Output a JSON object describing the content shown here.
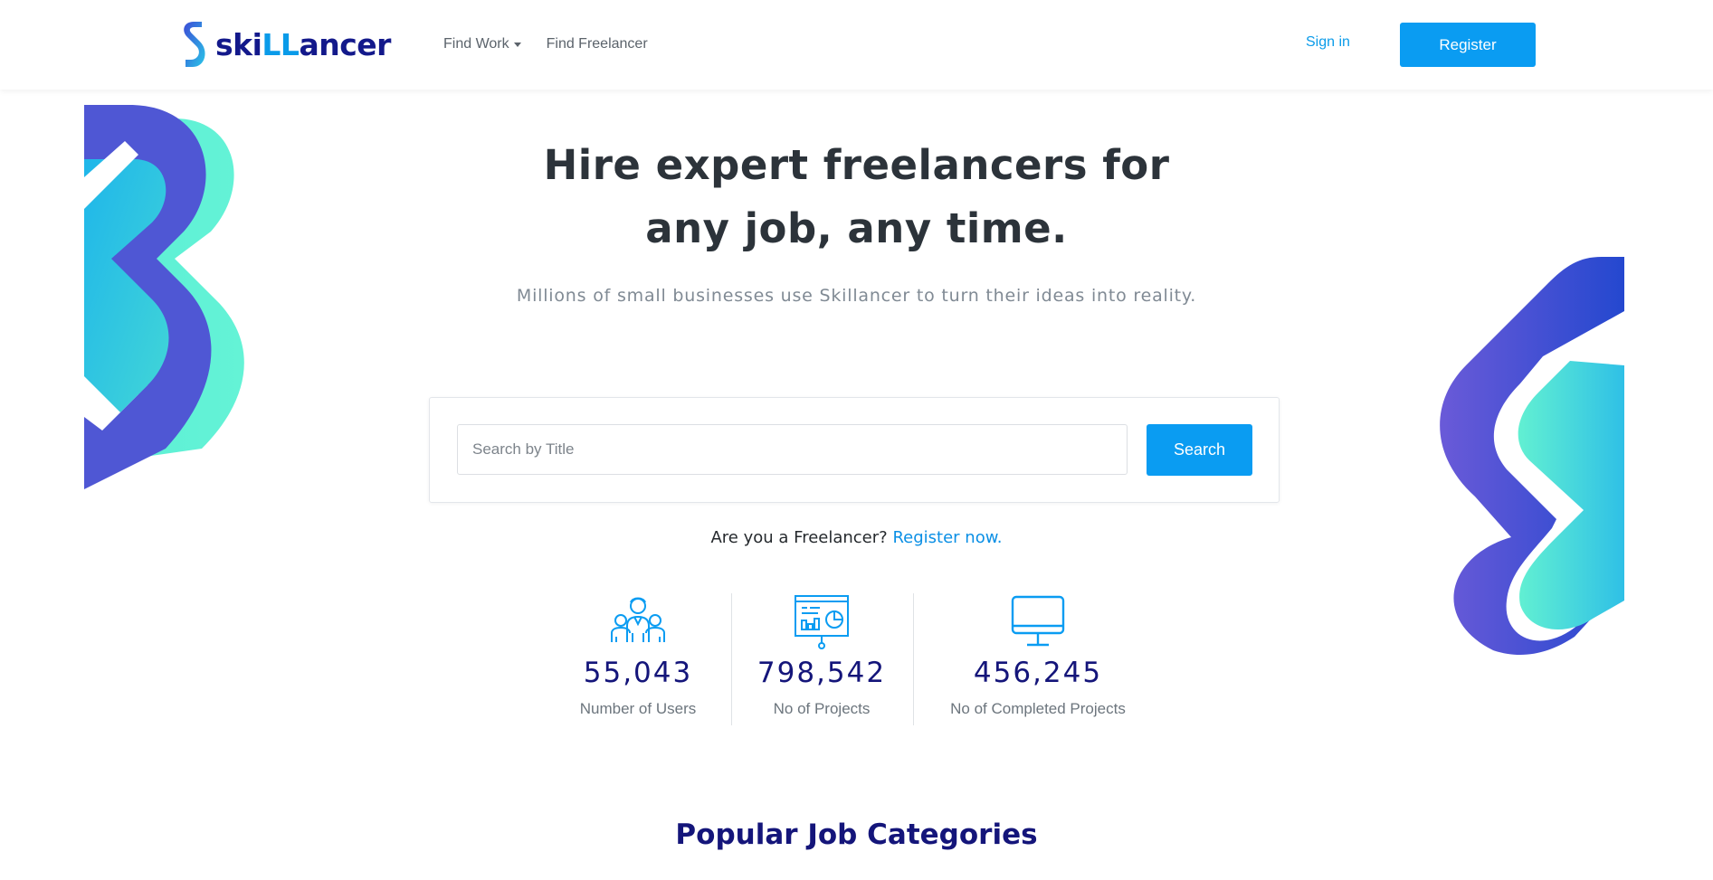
{
  "header": {
    "logo_text_pre": "ski",
    "logo_text_ll": "LL",
    "logo_text_post": "ancer",
    "nav": [
      {
        "label": "Find Work",
        "has_dropdown": true
      },
      {
        "label": "Find Freelancer",
        "has_dropdown": false
      }
    ],
    "signin_label": "Sign in",
    "register_label": "Register"
  },
  "hero": {
    "title_line1": "Hire expert freelancers for",
    "title_line2": "any job, any time.",
    "subtitle": "Millions of small businesses use Skillancer to turn their ideas into reality."
  },
  "search": {
    "placeholder": "Search by Title",
    "value": "",
    "button_label": "Search"
  },
  "freelancer_prompt": {
    "question": "Are you a Freelancer?",
    "link": "Register now."
  },
  "stats": [
    {
      "icon": "users-icon",
      "value": "55,043",
      "label": "Number of Users"
    },
    {
      "icon": "presentation-chart-icon",
      "value": "798,542",
      "label": "No of Projects"
    },
    {
      "icon": "monitor-icon",
      "value": "456,245",
      "label": "No of Completed Projects"
    }
  ],
  "categories": {
    "title_regular": "Popular Job",
    "title_bold": "Categories"
  },
  "colors": {
    "primary": "#0a9cf2",
    "navy": "#14157a",
    "text_dark": "#2c333a",
    "text_muted": "#808a94"
  }
}
